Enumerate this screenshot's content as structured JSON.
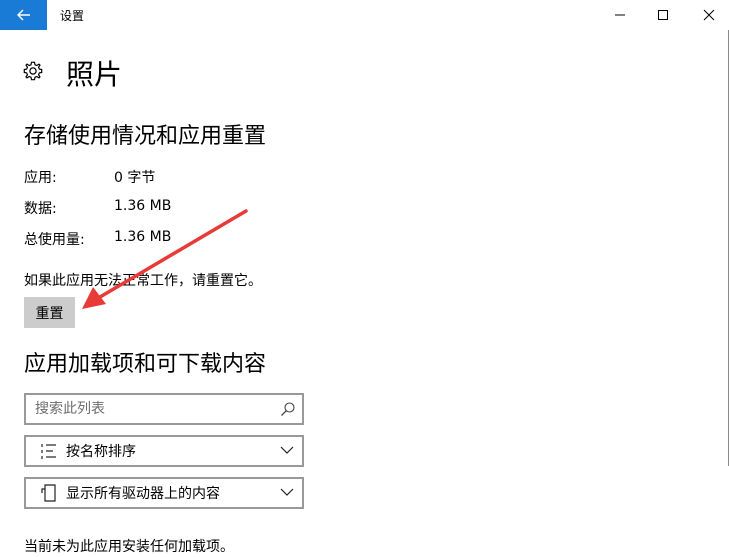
{
  "window": {
    "title": "设置",
    "accent_color": "#1a7bd6"
  },
  "page": {
    "title": "照片"
  },
  "storage": {
    "heading": "存储使用情况和应用重置",
    "rows": [
      {
        "label": "应用:",
        "value": "0 字节"
      },
      {
        "label": "数据:",
        "value": "1.36 MB"
      },
      {
        "label": "总使用量:",
        "value": "1.36 MB"
      }
    ],
    "reset_description": "如果此应用无法正常工作，请重置它。",
    "reset_label": "重置"
  },
  "addons": {
    "heading": "应用加载项和可下载内容",
    "search_placeholder": "搜索此列表",
    "sort_label": "按名称排序",
    "filter_label": "显示所有驱动器上的内容",
    "empty_note": "当前未为此应用安装任何加载项。"
  },
  "annotation": {
    "arrow_color": "#e83a36"
  }
}
